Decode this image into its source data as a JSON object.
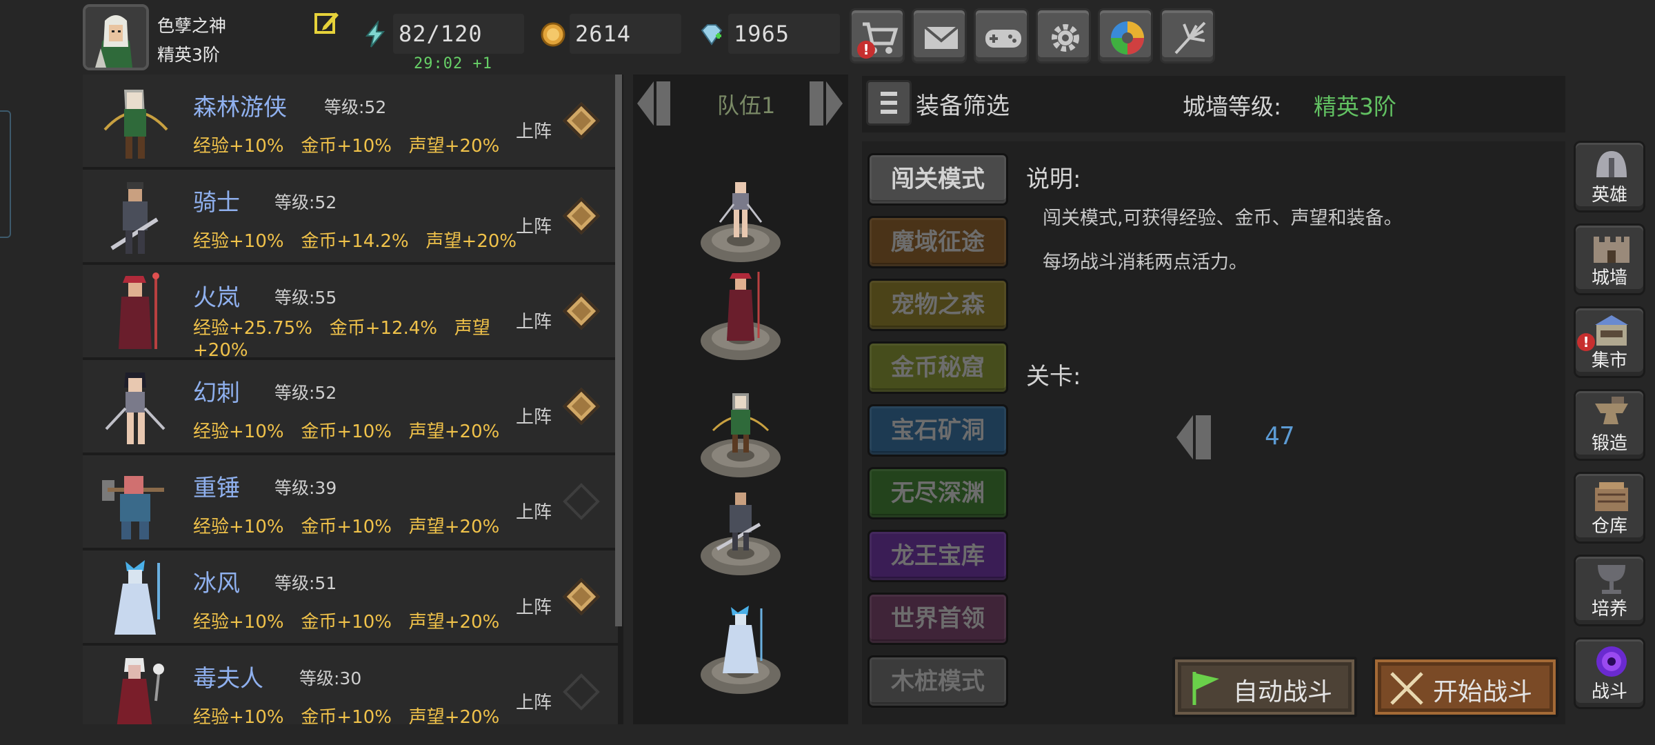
{
  "player": {
    "name": "色孽之神",
    "rank": "精英3阶"
  },
  "resources": {
    "energy": "82/120",
    "regen_timer": "29:02 +1",
    "gold": "2614",
    "gems": "1965"
  },
  "heroes": [
    {
      "name": "森林游侠",
      "level": "等级:52",
      "stats": "经验+10%   金币+10%   声望+20%",
      "deploy": "上阵",
      "deployed": true
    },
    {
      "name": "骑士",
      "level": "等级:52",
      "stats": "经验+10%   金币+14.2%   声望+20%",
      "deploy": "上阵",
      "deployed": true
    },
    {
      "name": "火岚",
      "level": "等级:55",
      "stats": "经验+25.75%   金币+12.4%   声望\n+20%",
      "deploy": "上阵",
      "deployed": true
    },
    {
      "name": "幻刺",
      "level": "等级:52",
      "stats": "经验+10%   金币+10%   声望+20%",
      "deploy": "上阵",
      "deployed": true
    },
    {
      "name": "重锤",
      "level": "等级:39",
      "stats": "经验+10%   金币+10%   声望+20%",
      "deploy": "上阵",
      "deployed": false
    },
    {
      "name": "冰风",
      "level": "等级:51",
      "stats": "经验+10%   金币+10%   声望+20%",
      "deploy": "上阵",
      "deployed": true
    },
    {
      "name": "毒夫人",
      "level": "等级:30",
      "stats": "经验+10%   金币+10%   声望+20%",
      "deploy": "上阵",
      "deployed": false
    }
  ],
  "team": {
    "label": "队伍1"
  },
  "filter": {
    "label": "装备筛选",
    "wall_label": "城墙等级:",
    "wall_value": "精英3阶"
  },
  "modes": [
    {
      "label": "闯关模式",
      "color": "#4a4a4a",
      "active": true
    },
    {
      "label": "魔域征途",
      "color": "#4a3318"
    },
    {
      "label": "宠物之森",
      "color": "#4b4318"
    },
    {
      "label": "金币秘窟",
      "color": "#464d1c"
    },
    {
      "label": "宝石矿洞",
      "color": "#1d3a52"
    },
    {
      "label": "无尽深渊",
      "color": "#23431c"
    },
    {
      "label": "龙王宝库",
      "color": "#3a1d55"
    },
    {
      "label": "世界首领",
      "color": "#3f2438"
    },
    {
      "label": "木桩模式",
      "color": "#3b3b3b"
    }
  ],
  "description": {
    "title": "说明:",
    "line1": "闯关模式,可获得经验、金币、声望和装备。",
    "line2": "每场战斗消耗两点活力。"
  },
  "stage": {
    "title": "关卡:",
    "number": "47"
  },
  "buttons": {
    "auto_battle": "自动战斗",
    "start_battle": "开始战斗"
  },
  "side_menu": [
    {
      "label": "英雄",
      "icon": "helmet-icon"
    },
    {
      "label": "城墙",
      "icon": "castle-icon"
    },
    {
      "label": "集市",
      "icon": "market-icon",
      "badge": "!"
    },
    {
      "label": "锻造",
      "icon": "anvil-icon"
    },
    {
      "label": "仓库",
      "icon": "warehouse-icon"
    },
    {
      "label": "培养",
      "icon": "chalice-icon"
    },
    {
      "label": "战斗",
      "icon": "portal-icon"
    }
  ],
  "top_buttons": [
    {
      "icon": "shop-cart-icon",
      "badge": "!"
    },
    {
      "icon": "mail-icon"
    },
    {
      "icon": "gamepad-icon"
    },
    {
      "icon": "gear-icon"
    },
    {
      "icon": "color-wheel-icon"
    },
    {
      "icon": "fireworks-icon"
    }
  ],
  "colors": {
    "hero_name": "#8fb0ee",
    "stat_text": "#f0c24a",
    "rank_green": "#62c162",
    "stage_number": "#5c9bd4"
  }
}
